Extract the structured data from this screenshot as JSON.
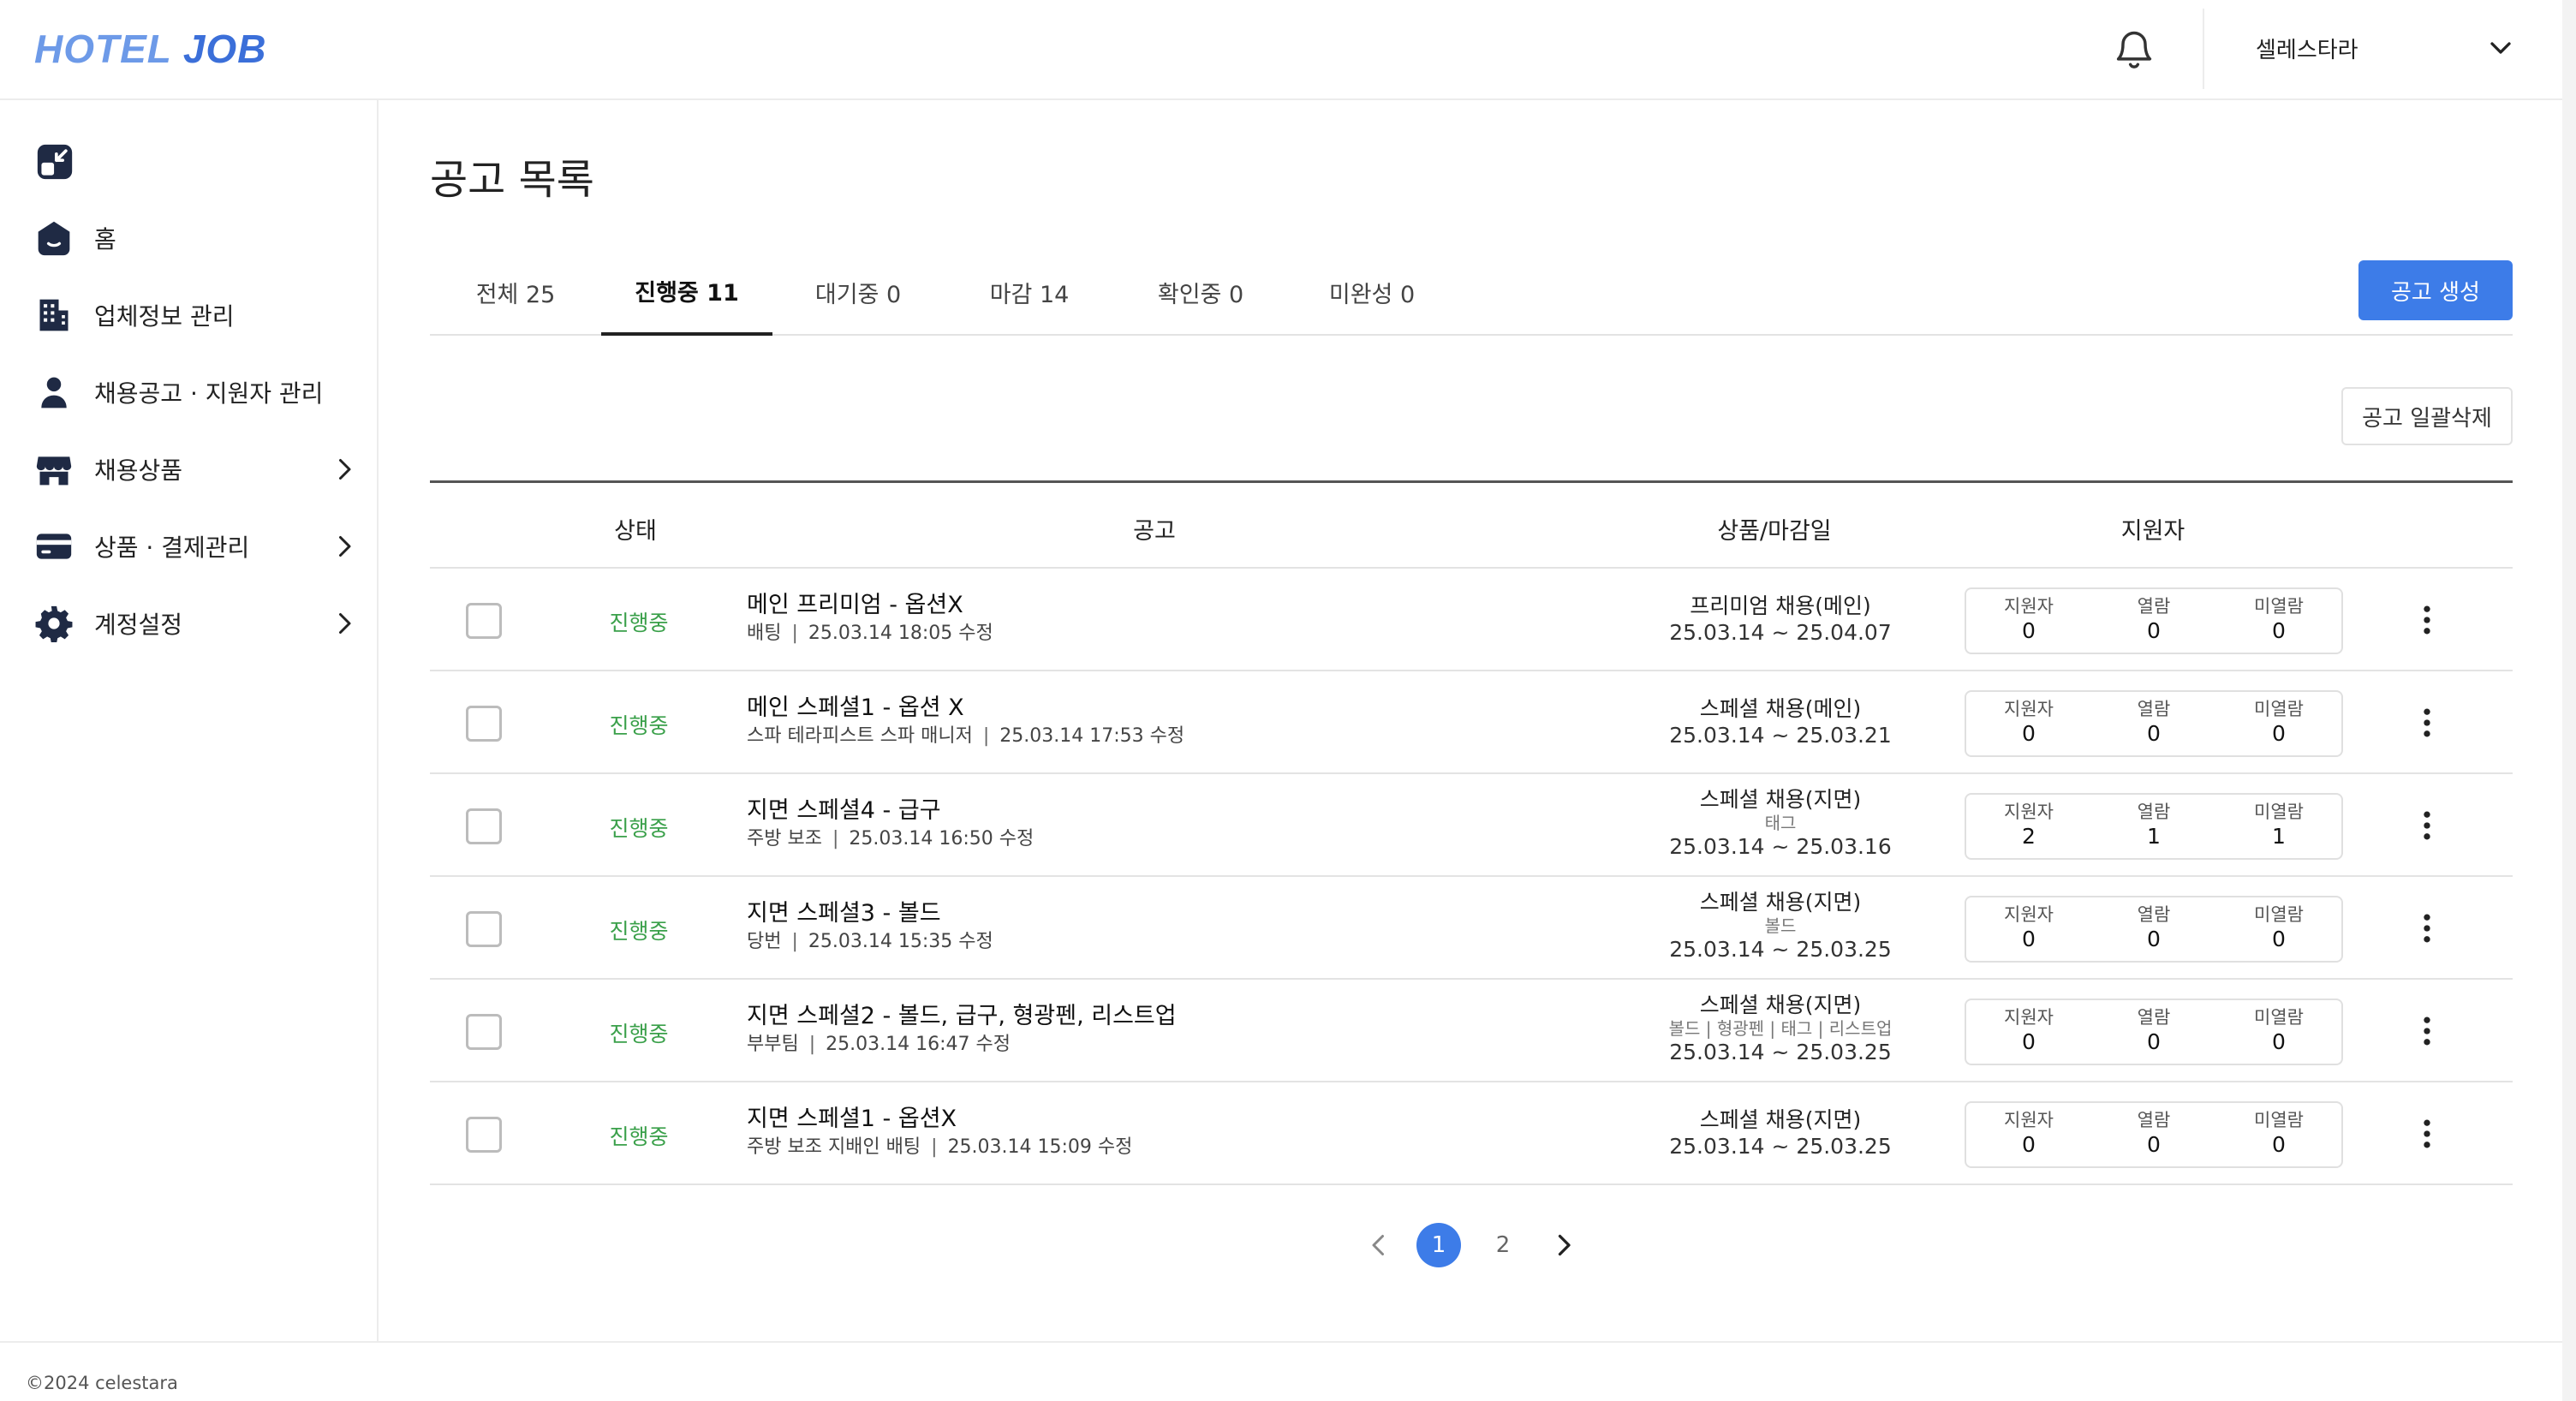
{
  "header": {
    "logo_part1": "HOTEL",
    "logo_part2": "JOB",
    "company_name": "셀레스타라",
    "bell_icon": "bell-icon",
    "dropdown_icon": "chevron-down-icon"
  },
  "sidebar": {
    "items": [
      {
        "label": "홈",
        "icon": "home-icon",
        "has_arrow": false
      },
      {
        "label": "업체정보 관리",
        "icon": "building-icon",
        "has_arrow": false
      },
      {
        "label": "채용공고 · 지원자 관리",
        "icon": "person-icon",
        "has_arrow": false
      },
      {
        "label": "채용상품",
        "icon": "store-icon",
        "has_arrow": true
      },
      {
        "label": "상품 · 결제관리",
        "icon": "card-icon",
        "has_arrow": true
      },
      {
        "label": "계정설정",
        "icon": "gear-icon",
        "has_arrow": true
      }
    ]
  },
  "page": {
    "title": "공고 목록",
    "create_button": "공고 생성",
    "bulk_delete_button": "공고 일괄삭제"
  },
  "tabs": [
    {
      "label": "전체 25",
      "active": false
    },
    {
      "label": "진행중 11",
      "active": true
    },
    {
      "label": "대기중 0",
      "active": false
    },
    {
      "label": "마감 14",
      "active": false
    },
    {
      "label": "확인중 0",
      "active": false
    },
    {
      "label": "미완성 0",
      "active": false
    }
  ],
  "table": {
    "headers": {
      "status": "상태",
      "job": "공고",
      "product": "상품/마감일",
      "applicants": "지원자"
    },
    "stat_labels": {
      "applicants": "지원자",
      "viewed": "열람",
      "unviewed": "미열람"
    },
    "rows": [
      {
        "status": "진행중",
        "title": "메인 프리미엄 - 옵션X",
        "sub_position": "배팅",
        "sub_modified": "25.03.14 18:05 수정",
        "product": "프리미엄 채용(메인)",
        "tag": "",
        "period": "25.03.14 ~ 25.04.07",
        "applicants": "0",
        "viewed": "0",
        "unviewed": "0"
      },
      {
        "status": "진행중",
        "title": "메인 스페셜1 - 옵션 X",
        "sub_position": "스파 테라피스트 스파 매니저",
        "sub_modified": "25.03.14 17:53 수정",
        "product": "스페셜 채용(메인)",
        "tag": "",
        "period": "25.03.14 ~ 25.03.21",
        "applicants": "0",
        "viewed": "0",
        "unviewed": "0"
      },
      {
        "status": "진행중",
        "title": "지면 스페셜4 - 급구",
        "sub_position": "주방 보조",
        "sub_modified": "25.03.14 16:50 수정",
        "product": "스페셜 채용(지면)",
        "tag": "태그",
        "period": "25.03.14 ~ 25.03.16",
        "applicants": "2",
        "viewed": "1",
        "unviewed": "1"
      },
      {
        "status": "진행중",
        "title": "지면 스페셜3 - 볼드",
        "sub_position": "당번",
        "sub_modified": "25.03.14 15:35 수정",
        "product": "스페셜 채용(지면)",
        "tag": "볼드",
        "period": "25.03.14 ~ 25.03.25",
        "applicants": "0",
        "viewed": "0",
        "unviewed": "0"
      },
      {
        "status": "진행중",
        "title": "지면 스페셜2 - 볼드, 급구, 형광펜, 리스트업",
        "sub_position": "부부팀",
        "sub_modified": "25.03.14 16:47 수정",
        "product": "스페셜 채용(지면)",
        "tag": "볼드 | 형광펜 | 태그 | 리스트업",
        "period": "25.03.14 ~ 25.03.25",
        "applicants": "0",
        "viewed": "0",
        "unviewed": "0"
      },
      {
        "status": "진행중",
        "title": "지면 스페셜1 - 옵션X",
        "sub_position": "주방 보조 지배인 배팅",
        "sub_modified": "25.03.14 15:09 수정",
        "product": "스페셜 채용(지면)",
        "tag": "",
        "period": "25.03.14 ~ 25.03.25",
        "applicants": "0",
        "viewed": "0",
        "unviewed": "0"
      }
    ]
  },
  "pagination": {
    "pages": [
      "1",
      "2"
    ],
    "current": "1"
  },
  "footer": {
    "copyright": "©2024 celestara"
  },
  "colors": {
    "accent": "#3d7ce8",
    "status_active": "#3aa04a",
    "logo_light": "#6d9ae8",
    "logo_dark": "#3b6fd9"
  }
}
